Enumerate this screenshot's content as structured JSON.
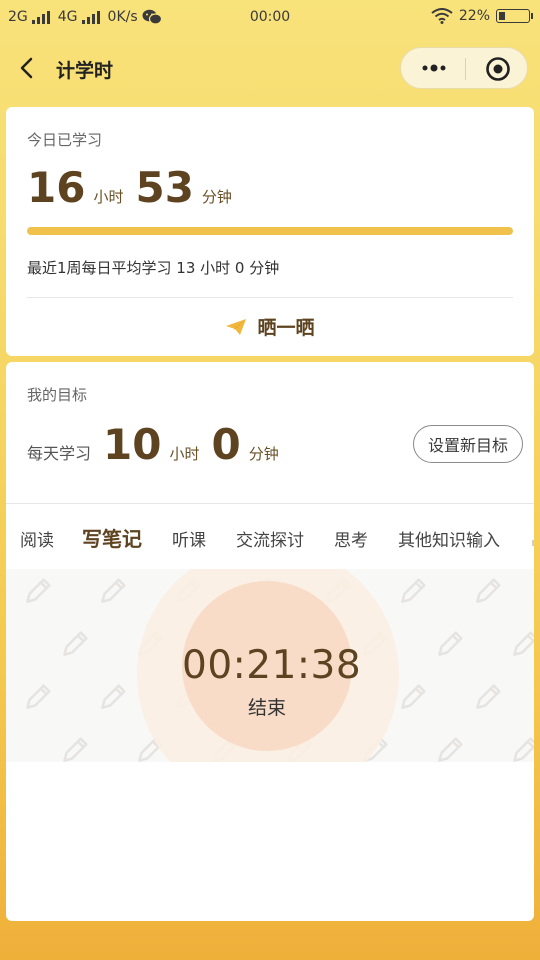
{
  "status_bar": {
    "net1": "2G",
    "net2": "4G",
    "speed": "0K/s",
    "time": "00:00",
    "battery_text": "22%",
    "battery_level": 0.22
  },
  "nav": {
    "title": "计学时"
  },
  "today": {
    "label": "今日已学习",
    "hours": "16",
    "hours_unit": "小时",
    "minutes": "53",
    "minutes_unit": "分钟",
    "progress": 1.0,
    "weekly_avg": "最近1周每日平均学习 13 小时 0 分钟",
    "share_label": "晒一晒"
  },
  "goal": {
    "label": "我的目标",
    "prefix": "每天学习",
    "hours": "10",
    "hours_unit": "小时",
    "minutes": "0",
    "minutes_unit": "分钟",
    "set_button": "设置新目标"
  },
  "tabs": [
    "阅读",
    "写笔记",
    "听课",
    "交流探讨",
    "思考",
    "其他知识输入"
  ],
  "active_tab": 1,
  "timer": {
    "value": "00:21:38",
    "end_label": "结束"
  },
  "colors": {
    "accent": "#5e4321",
    "progress": "#f0c24b",
    "timer_circle": "#f8dcc8",
    "background_top": "#f8e27a",
    "background_bottom": "#efb03a"
  }
}
